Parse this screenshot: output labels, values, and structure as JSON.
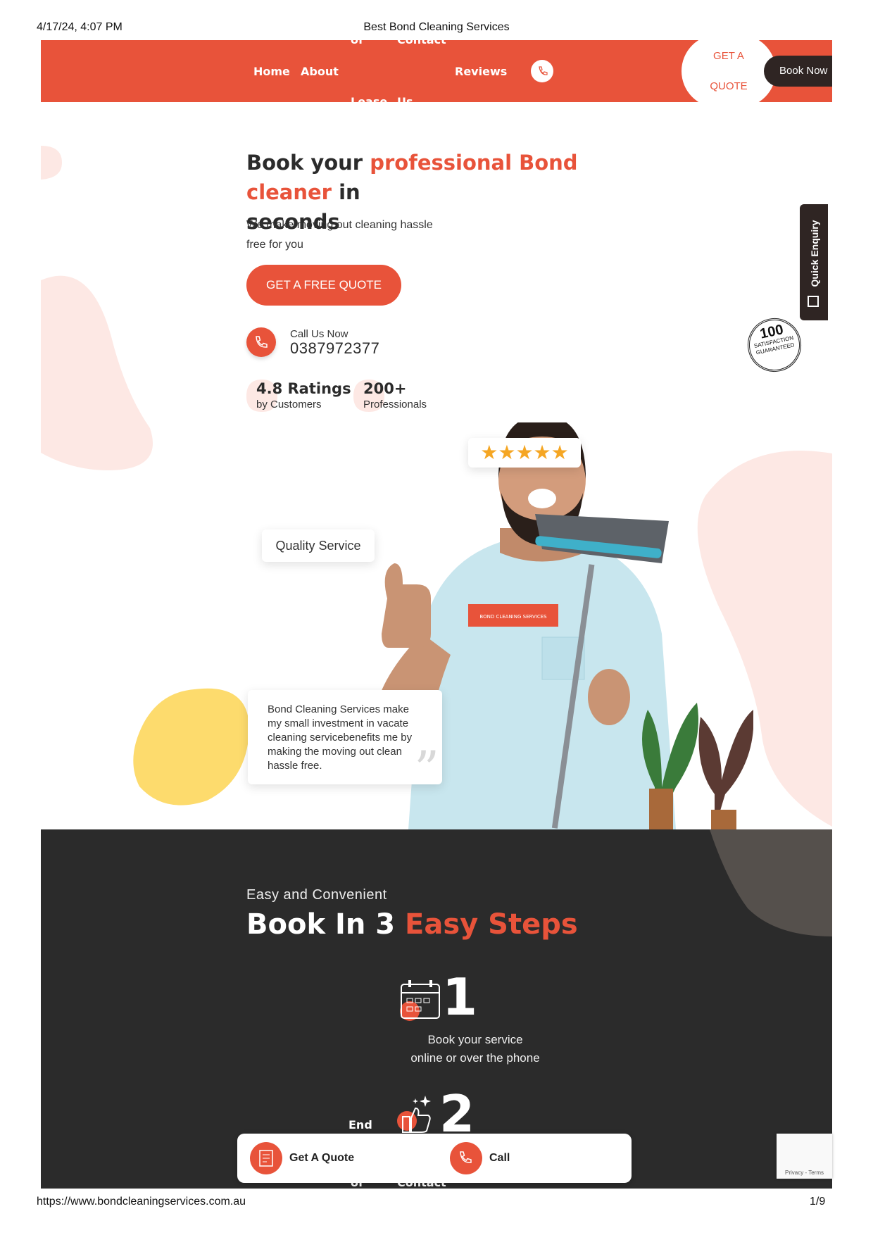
{
  "print_header": {
    "datetime": "4/17/24, 4:07 PM",
    "page_title": "Best Bond Cleaning Services"
  },
  "nav": {
    "home": "Home",
    "about": "About",
    "frag_top_left": "of",
    "frag_top_right": "Contact",
    "frag_bottom_left": "Lease",
    "frag_bottom_right": "Us",
    "reviews": "Reviews",
    "get_quote_line1": "GET A",
    "get_quote_line2": "QUOTE",
    "book_now": "Book Now"
  },
  "hero": {
    "title_pre": "Book your ",
    "title_accent": "professional Bond cleaner",
    "title_post": " in",
    "title_line2": "seconds",
    "subtitle_line1": "We make moving out cleaning hassle",
    "subtitle_line2": "free for you",
    "cta": "GET A FREE QUOTE",
    "call_label": "Call Us Now",
    "call_number": "0387972377",
    "stat1_value": "4.8 Ratings",
    "stat1_label": "by Customers",
    "stat2_value": "200+",
    "stat2_label": "Professionals",
    "quality_badge": "Quality Service",
    "rating_stars": 5,
    "testimonial": "Bond Cleaning Services make my small investment in vacate cleaning servicebenefits me by making the moving out clean hassle free.",
    "shirt_text": "BOND CLEANING SERVICES"
  },
  "quick_enquiry": "Quick Enquiry",
  "seal": {
    "line1": "100",
    "line2": "SATISFACTION",
    "line3": "GUARANTEED"
  },
  "steps_section": {
    "eyebrow": "Easy and Convenient",
    "title_pre": "Book In 3 ",
    "title_accent": "Easy Steps",
    "step1_number": "1",
    "step1_line1": "Book your service",
    "step1_line2": "online or over the phone",
    "step2_number": "2",
    "frag_end": "End",
    "frag_of": "of",
    "frag_contact": "Contact"
  },
  "bottom_bar": {
    "quote_label": "Get A Quote",
    "call_label": "Call"
  },
  "recaptcha": {
    "text": "Privacy - Terms"
  },
  "print_footer": {
    "url": "https://www.bondcleaningservices.com.au",
    "page": "1/9"
  },
  "colors": {
    "accent": "#e8533a",
    "dark": "#2b2b2b",
    "blob_pink": "#fde8e4",
    "blob_yellow": "#fddb6d",
    "brown": "#2f2523"
  }
}
